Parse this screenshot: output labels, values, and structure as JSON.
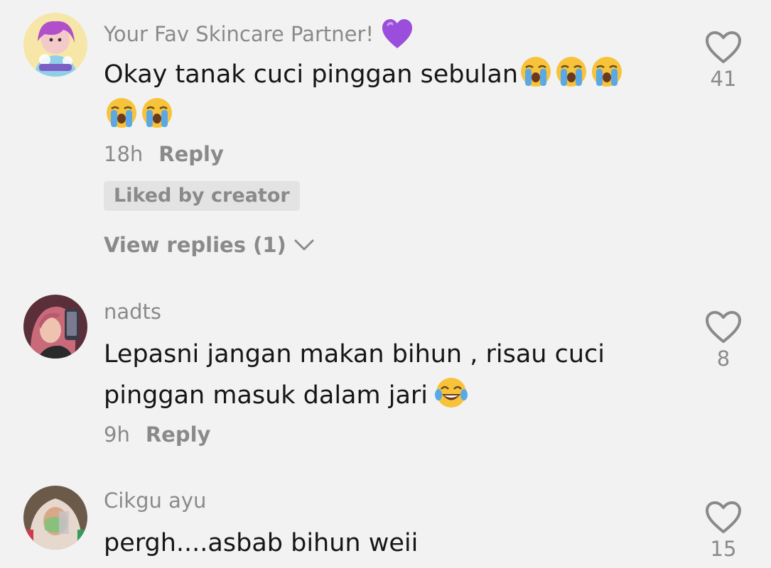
{
  "comments": [
    {
      "username": "Your Fav Skincare Partner!",
      "username_badge": "purple-heart-emoji",
      "text": "Okay tanak cuci pinggan sebulan",
      "text_emojis": [
        "loudly-crying-face",
        "loudly-crying-face",
        "loudly-crying-face",
        "loudly-crying-face",
        "loudly-crying-face"
      ],
      "time": "18h",
      "reply_label": "Reply",
      "liked_badge": "Liked by creator",
      "view_replies": "View replies (1)",
      "like_count": "41"
    },
    {
      "username": "nadts",
      "text_line1": "Lepasni jangan makan bihun , risau cuci",
      "text_line2": "pinggan masuk dalam jari",
      "text_emojis": [
        "face-with-tears-of-joy"
      ],
      "time": "9h",
      "reply_label": "Reply",
      "like_count": "8"
    },
    {
      "username": "Cikgu ayu",
      "text": "pergh....asbab bihun weii",
      "like_count": "15"
    }
  ],
  "colors": {
    "background": "#f2f2f2",
    "primary_text": "#161616",
    "secondary_text": "#8a8a8a",
    "badge_background": "#e3e3e3",
    "purple_heart": "#9b4ddb"
  },
  "icons": {
    "like": "heart-outline-icon",
    "expand": "chevron-down-icon"
  }
}
